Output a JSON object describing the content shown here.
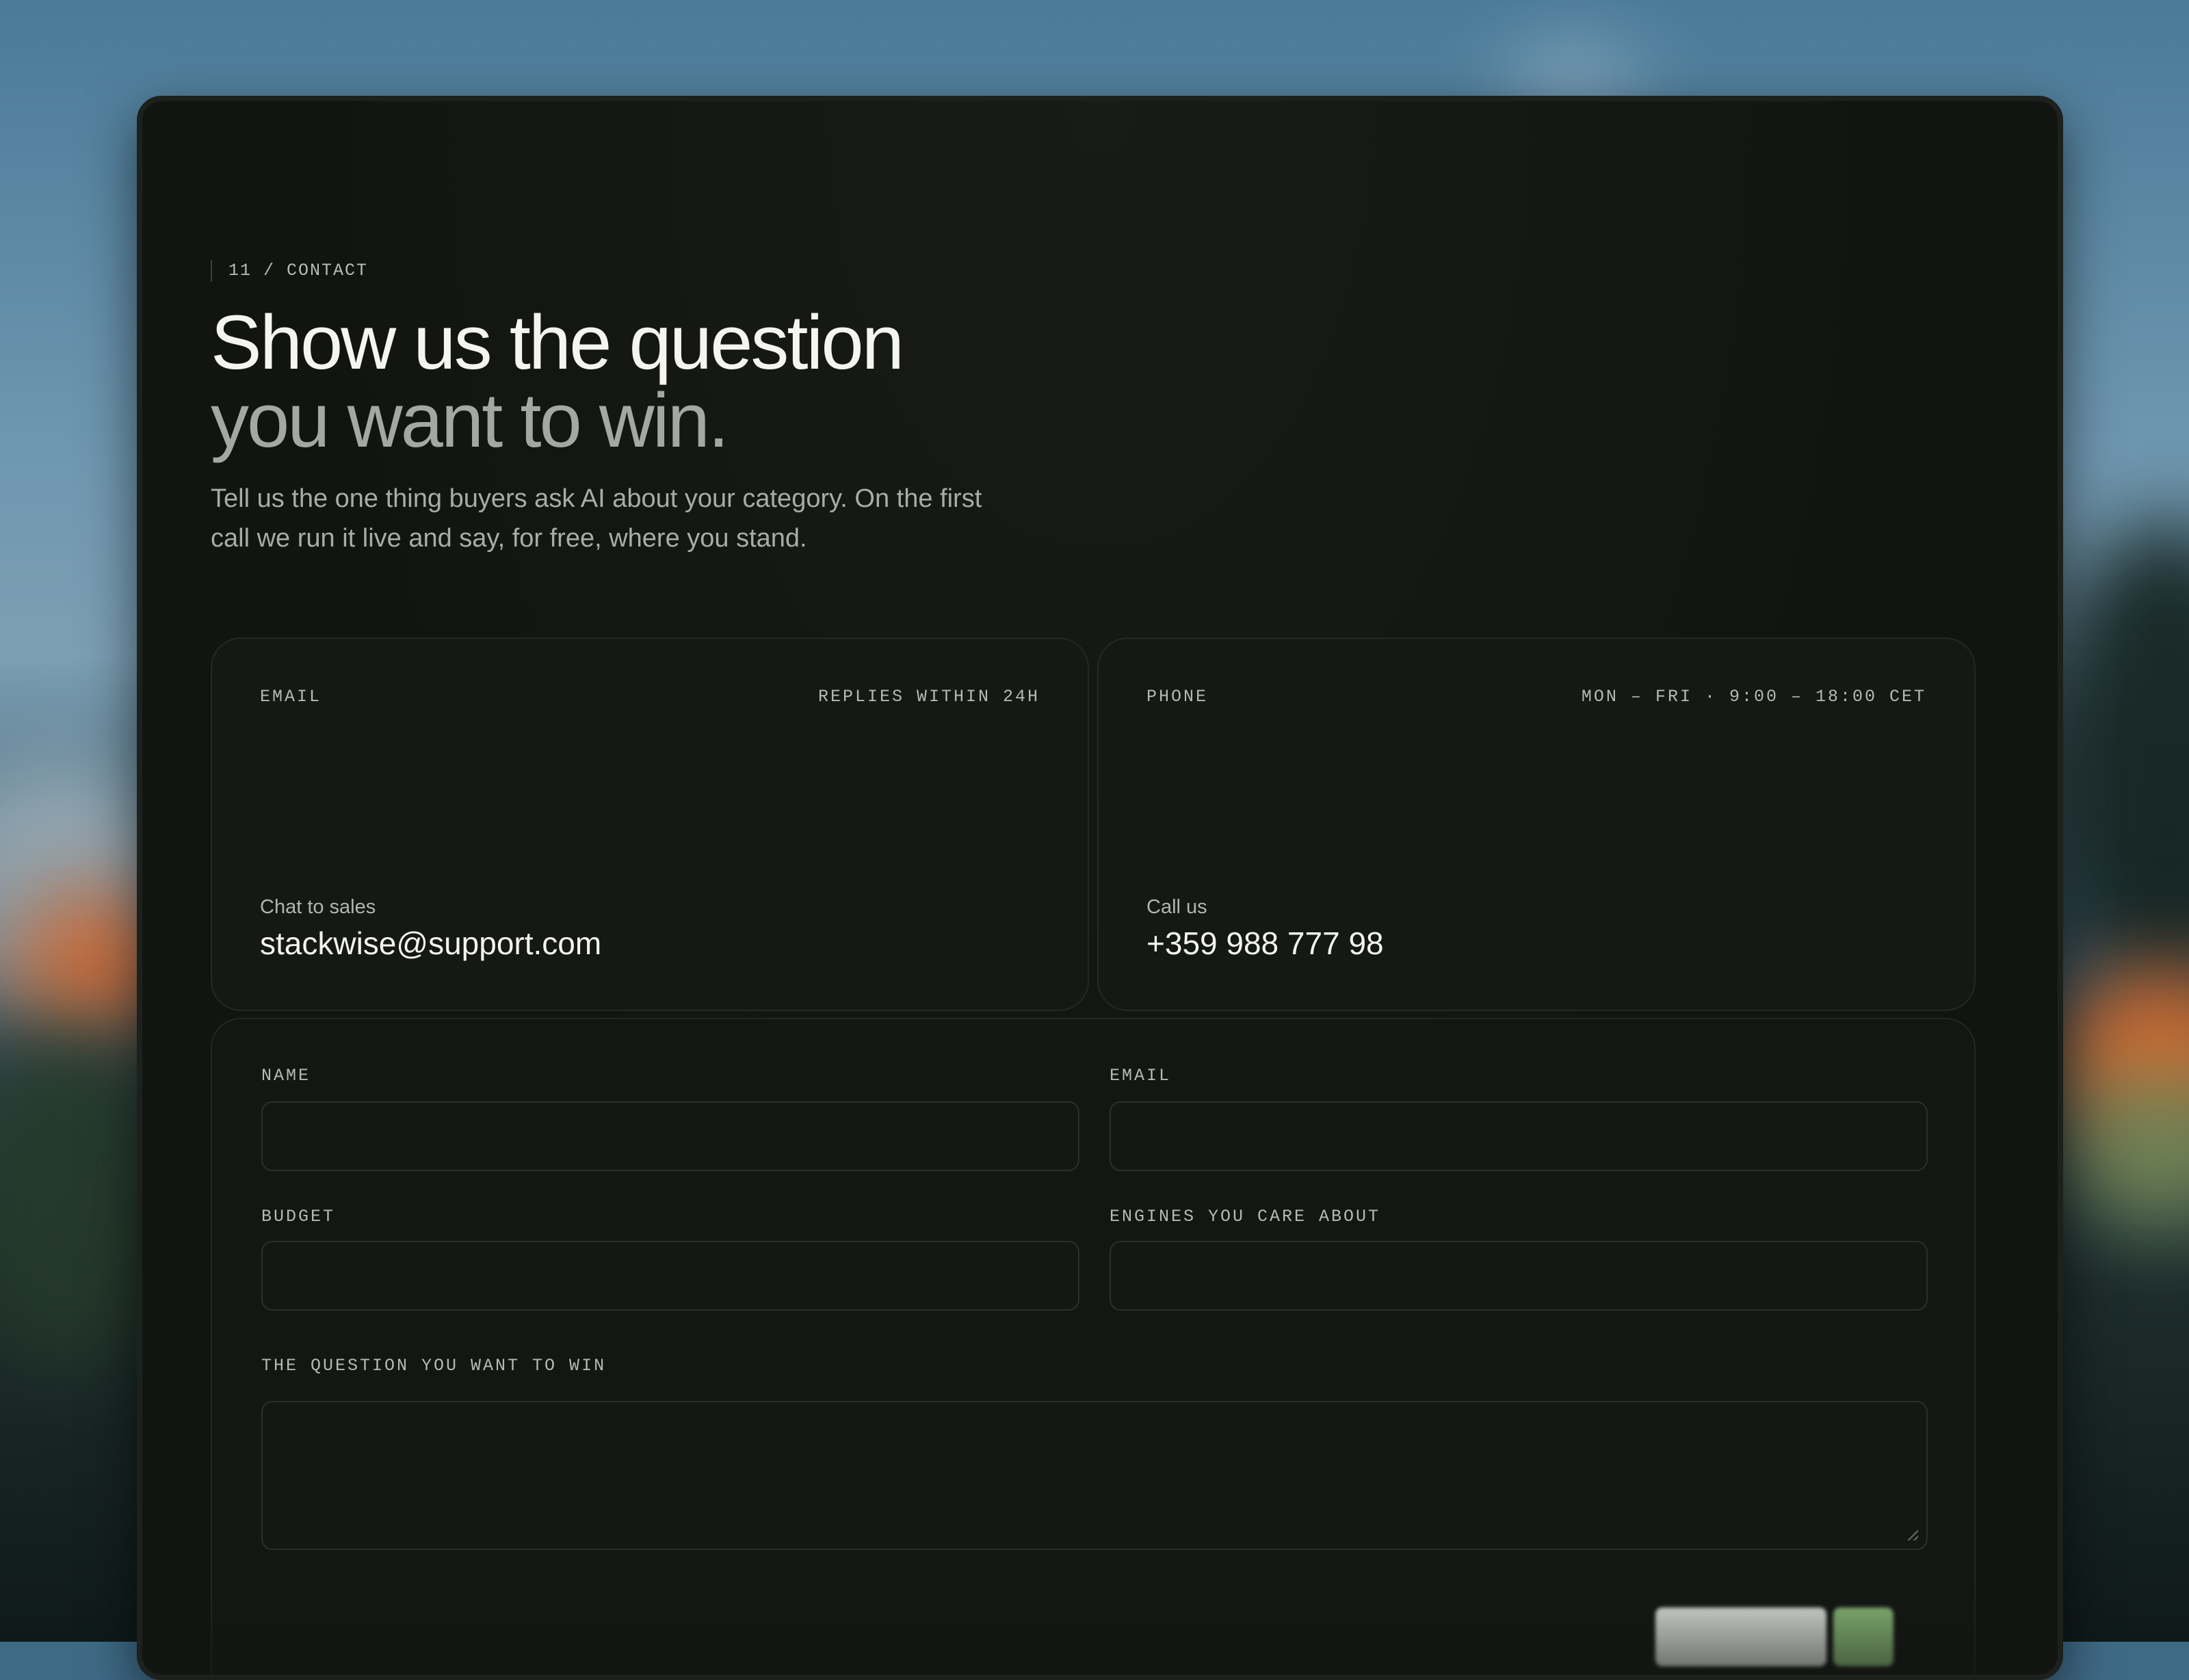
{
  "section": {
    "eyebrow": "11 / CONTACT"
  },
  "hero": {
    "title_line1": "Show us the question",
    "title_line2": "you want to win.",
    "lede": "Tell us the one thing buyers ask AI about your category. On the first call we run it live and say, for free, where you stand."
  },
  "email_card": {
    "tag": "EMAIL",
    "meta": "REPLIES WITHIN 24H",
    "caption": "Chat to sales",
    "value": "stackwise@support.com"
  },
  "phone_card": {
    "tag": "PHONE",
    "meta": "MON – FRI · 9:00 – 18:00 CET",
    "caption": "Call us",
    "value": "+359 988 777 98"
  },
  "form": {
    "name_label": "NAME",
    "email_label": "EMAIL",
    "budget_label": "BUDGET",
    "engines_label": "ENGINES YOU CARE ABOUT",
    "question_label": "THE QUESTION YOU WANT TO WIN"
  },
  "colors": {
    "window_bg": "#121412",
    "card_bg": "#151815",
    "text_primary": "#f4f5f2",
    "text_muted": "#a5a7a2",
    "accent_green": "#8fc27c"
  }
}
